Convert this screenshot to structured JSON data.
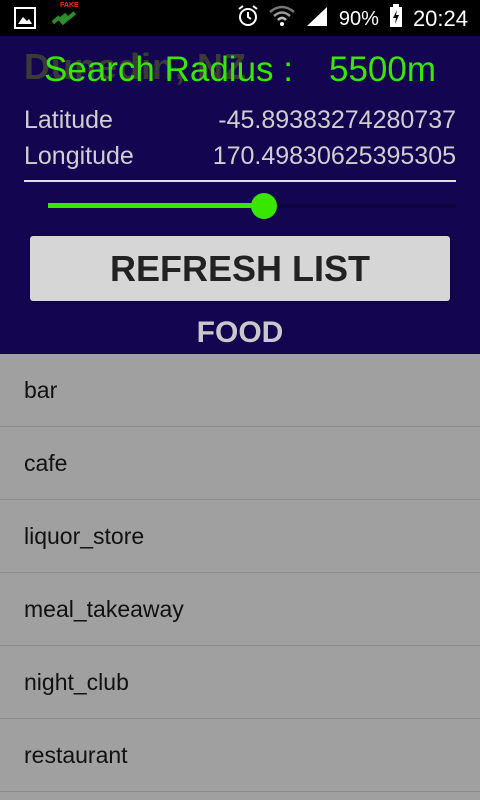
{
  "status_bar": {
    "battery": "90%",
    "time": "20:24",
    "fake_label": "FAKE",
    "icons": [
      "gallery-icon",
      "fake-gps-icon",
      "alarm-icon",
      "wifi-icon",
      "signal-icon",
      "battery-charging-icon"
    ]
  },
  "header": {
    "city": "Dunedin, NZ",
    "radius_label": "Search Radius :",
    "radius_value": "5500m",
    "latitude_label": "Latitude",
    "latitude_value": "-45.89383274280737",
    "longitude_label": "Longitude",
    "longitude_value": "170.49830625395305",
    "slider_fraction": 0.53,
    "refresh_label": "REFRESH LIST",
    "category": "FOOD"
  },
  "places": [
    "bar",
    "cafe",
    "liquor_store",
    "meal_takeaway",
    "night_club",
    "restaurant"
  ],
  "colors": {
    "header_bg": "#140550",
    "accent_green": "#39e600",
    "list_bg": "#a0a0a0",
    "button_bg": "#d6d6d6"
  }
}
